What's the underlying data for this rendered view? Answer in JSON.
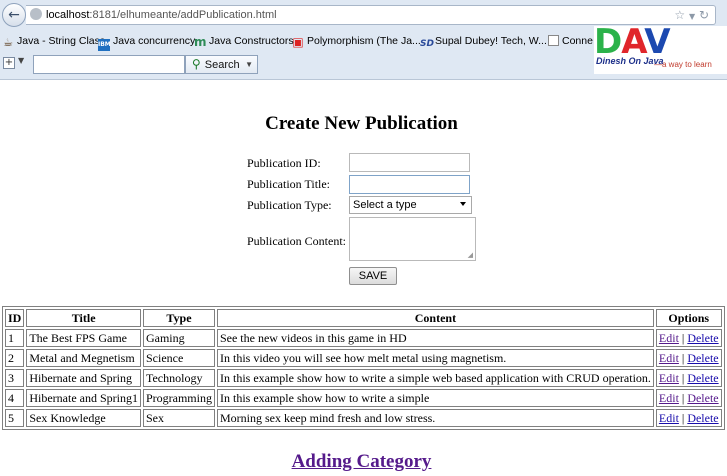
{
  "browser": {
    "back_icon": "back-arrow-icon",
    "url_host": "localhost",
    "url_rest": ":8181/elhumeante/addPublication.html",
    "bookmarks": [
      {
        "icon": "java-icon",
        "label": "Java - String Class"
      },
      {
        "icon": "ibm-icon",
        "label": "Java concurrency"
      },
      {
        "icon": "m-icon",
        "label": "Java Constructors"
      },
      {
        "icon": "o-icon",
        "label": "Polymorphism (The Ja..."
      },
      {
        "icon": "sd-icon",
        "label": "Supal Dubey! Tech, W..."
      },
      {
        "icon": "page-icon",
        "label": "Conne"
      }
    ],
    "search_label": "Search",
    "logo": {
      "letters": "DAV",
      "subtitle": "Dinesh On Java",
      "tagline": "—a way to learn"
    }
  },
  "page": {
    "title": "Create New Publication",
    "form": {
      "id_label": "Publication ID:",
      "title_label": "Publication Title:",
      "type_label": "Publication Type:",
      "type_selected": "Select a type",
      "content_label": "Publication Content:",
      "save_label": "SAVE"
    },
    "table": {
      "headers": [
        "ID",
        "Title",
        "Type",
        "Content",
        "Options"
      ],
      "edit_label": "Edit",
      "separator": "|",
      "delete_label": "Delete",
      "rows": [
        {
          "id": "1",
          "title": "The Best FPS Game",
          "type": "Gaming",
          "content": "See the new videos in this game in HD"
        },
        {
          "id": "2",
          "title": "Metal and Megnetism",
          "type": "Science",
          "content": "In this video you will see how melt metal using magnetism."
        },
        {
          "id": "3",
          "title": "Hibernate and Spring",
          "type": "Technology",
          "content": "In this example show how to write a simple web based application with CRUD operation."
        },
        {
          "id": "4",
          "title": "Hibernate and Spring1",
          "type": "Programming",
          "content": "In this example show how to write a simple"
        },
        {
          "id": "5",
          "title": "Sex Knowledge",
          "type": "Sex",
          "content": "Morning sex keep mind fresh and low stress."
        }
      ]
    },
    "footer_link": "Adding Category"
  }
}
